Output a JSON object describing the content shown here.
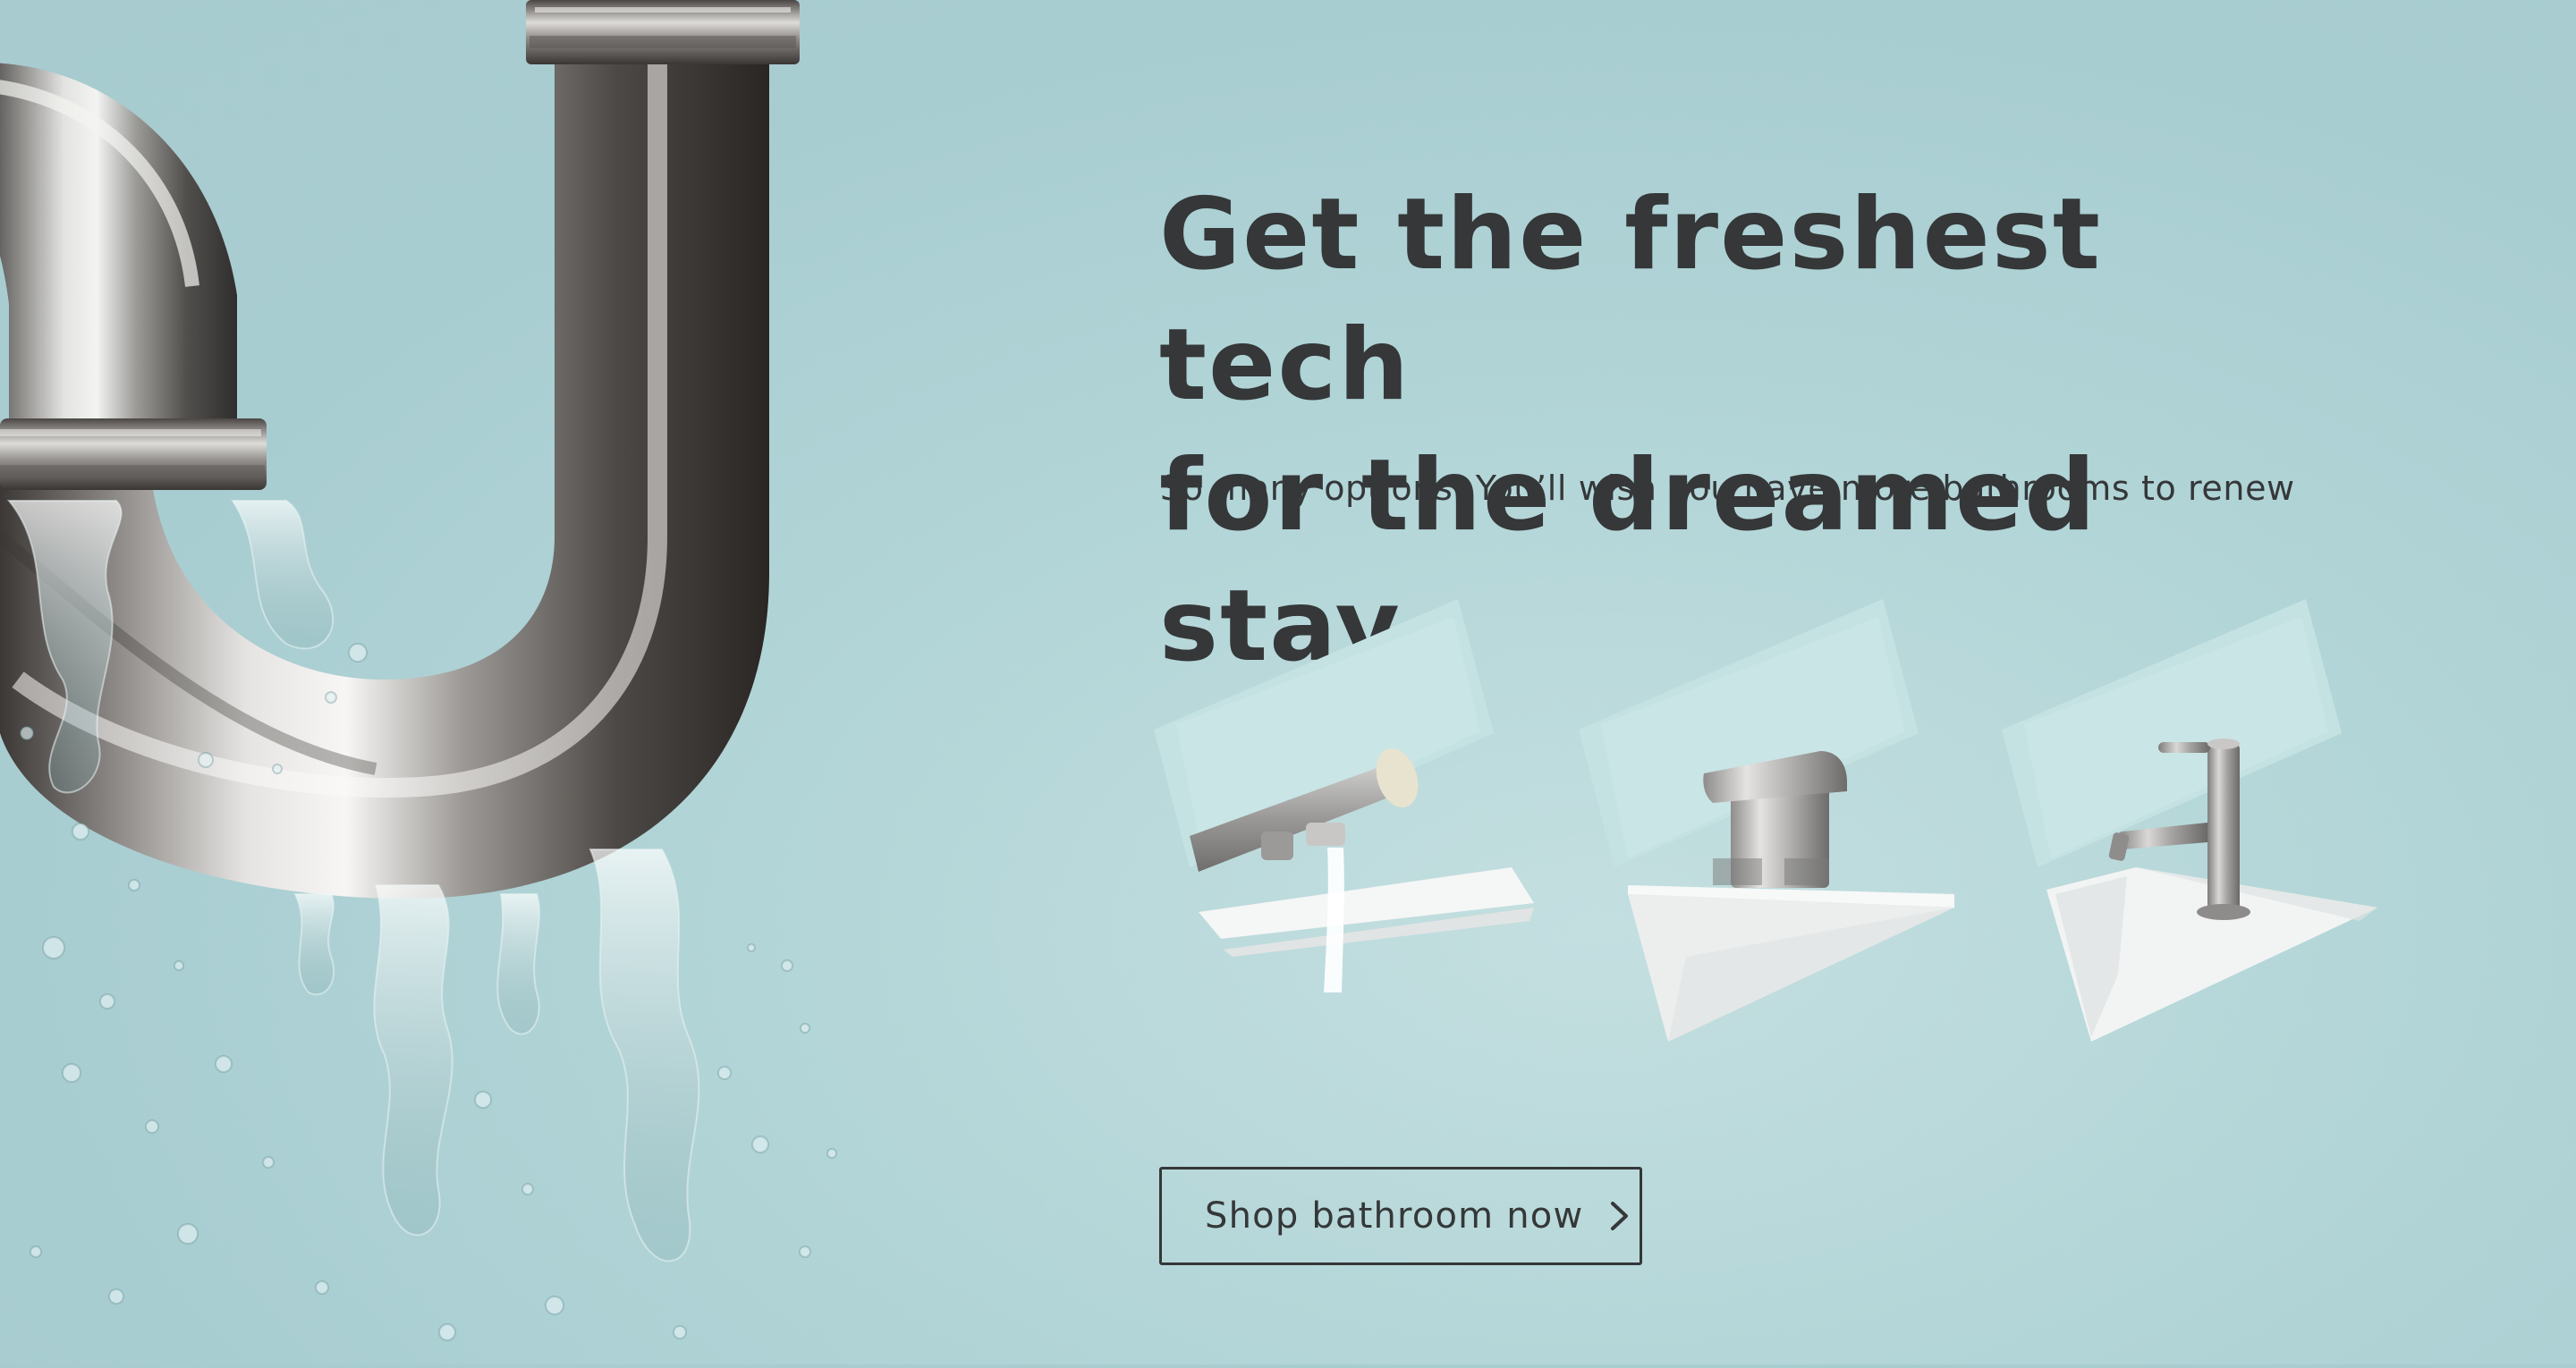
{
  "hero": {
    "headline_line1": "Get the freshest tech",
    "headline_line2": "for the dreamed stay",
    "subtitle": "So many options. You’ll wish you have more bathrooms to renew"
  },
  "cta": {
    "label": "Shop bathroom now",
    "icon": "chevron-right-icon"
  },
  "images": {
    "hero_image": "leaking-chrome-p-trap-pipe-with-water-splash",
    "products": [
      "chrome-wall-mounted-spout-with-running-water",
      "chrome-waterfall-basin-mixer-tap",
      "chrome-single-lever-basin-mixer-tap"
    ]
  },
  "colors": {
    "background": "#aacdd1",
    "text": "#353739",
    "tile": "#c5e2e3"
  }
}
